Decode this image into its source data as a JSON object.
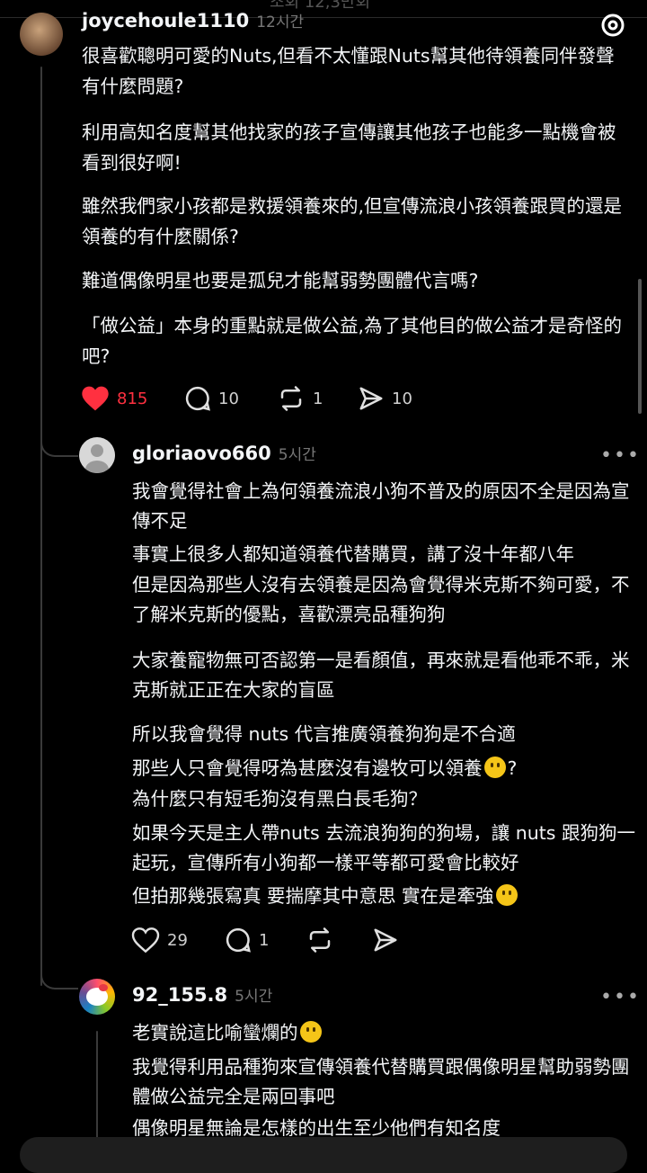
{
  "top_faded_label": "조회 12,3만회",
  "post": {
    "username": "joycehoule1110",
    "time": "12시간",
    "paragraphs": [
      "很喜歡聰明可愛的Nuts,但看不太懂跟Nuts幫其他待領養同伴發聲有什麼問題?",
      "利用高知名度幫其他找家的孩子宣傳讓其他孩子也能多一點機會被看到很好啊!",
      "雖然我們家小孩都是救援領養來的,但宣傳流浪小孩領養跟買的還是領養的有什麼關係?",
      "難道偶像明星也要是孤兒才能幫弱勢團體代言嗎?",
      "「做公益」本身的重點就是做公益,為了其他目的做公益才是奇怪的吧?"
    ],
    "likes": "815",
    "comments": "10",
    "reposts": "1",
    "shares": "10"
  },
  "reply1": {
    "username": "gloriaovo660",
    "time": "5시간",
    "more": "•••",
    "lines": [
      "我會覺得社會上為何領養流浪小狗不普及的原因不全是因為宣傳不足",
      "事實上很多人都知道領養代替購買，講了沒十年都八年",
      "但是因為那些人沒有去領養是因為會覺得米克斯不夠可愛，不了解米克斯的優點，喜歡漂亮品種狗狗"
    ],
    "lines_b": "大家養寵物無可否認第一是看顏值，再來就是看他乖不乖，米克斯就正正在大家的盲區",
    "lines_c1": "所以我會覺得 nuts 代言推廣領養狗狗是不合適",
    "lines_c2a": "那些人只會覺得呀為甚麼沒有邊牧可以領養",
    "lines_c2b": "?",
    "lines_c3": "為什麼只有短毛狗沒有黑白長毛狗？",
    "lines_c4": "如果今天是主人帶nuts 去流浪狗狗的狗場，讓 nuts 跟狗狗一起玩，宣傳所有小狗都一樣平等都可愛會比較好",
    "lines_c5": "但拍那幾張寫真 要揣摩其中意思 實在是牽強",
    "likes": "29",
    "comments": "1"
  },
  "reply2": {
    "username": "92_155.8",
    "time": "5시간",
    "more": "•••",
    "line1": "老實說這比喻蠻爛的",
    "line2": "我覺得利用品種狗來宣傳領養代替購買跟偶像明星幫助弱勢團體做公益完全是兩回事吧",
    "line3": "偶像明星無論是怎樣的出生至少他們有知名度"
  },
  "colors": {
    "like_red": "#ff3040",
    "background": "#000000",
    "text": "#f3f5f7",
    "muted": "#777777"
  }
}
